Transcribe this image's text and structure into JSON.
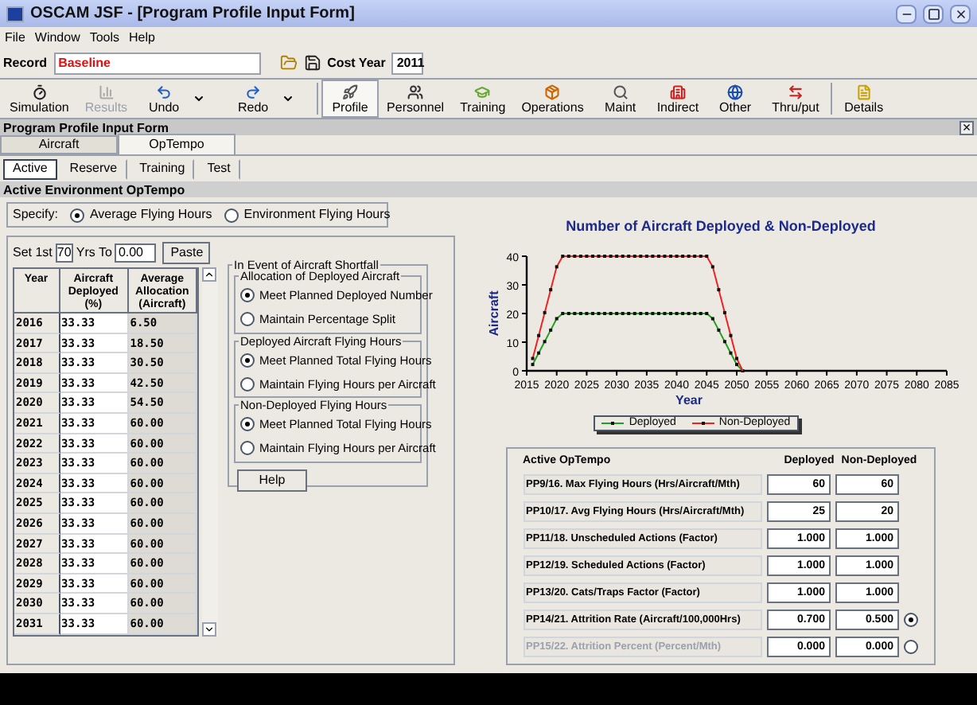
{
  "window": {
    "title": "OSCAM JSF - [Program Profile Input Form]"
  },
  "menu": [
    "File",
    "Window",
    "Tools",
    "Help"
  ],
  "record": {
    "label": "Record",
    "value": "Baseline",
    "cost_year_label": "Cost Year",
    "cost_year": "2011"
  },
  "toolbar": [
    {
      "label": "Simulation",
      "selected": false,
      "disabled": false,
      "kind": "plain"
    },
    {
      "label": "Results",
      "selected": false,
      "disabled": true,
      "kind": "plain"
    },
    {
      "label": "Undo",
      "selected": false,
      "disabled": false,
      "kind": "split"
    },
    {
      "label": "Redo",
      "selected": false,
      "disabled": false,
      "kind": "split"
    },
    {
      "label": "Profile",
      "selected": true,
      "disabled": false,
      "kind": "plain"
    },
    {
      "label": "Personnel",
      "selected": false,
      "disabled": false,
      "kind": "plain"
    },
    {
      "label": "Training",
      "selected": false,
      "disabled": false,
      "kind": "plain"
    },
    {
      "label": "Operations",
      "selected": false,
      "disabled": false,
      "kind": "plain"
    },
    {
      "label": "Maint",
      "selected": false,
      "disabled": false,
      "kind": "plain"
    },
    {
      "label": "Indirect",
      "selected": false,
      "disabled": false,
      "kind": "plain"
    },
    {
      "label": "Other",
      "selected": false,
      "disabled": false,
      "kind": "plain"
    },
    {
      "label": "Thru/put",
      "selected": false,
      "disabled": false,
      "kind": "plain"
    },
    {
      "label": "Details",
      "selected": false,
      "disabled": false,
      "kind": "plain"
    }
  ],
  "form": {
    "title": "Program Profile Input Form",
    "close": "×"
  },
  "tabs": [
    {
      "label": "Aircraft",
      "selected": false
    },
    {
      "label": "OpTempo",
      "selected": true
    }
  ],
  "subtabs": [
    {
      "label": "Active",
      "selected": true
    },
    {
      "label": "Reserve",
      "selected": false
    },
    {
      "label": "Training",
      "selected": false
    },
    {
      "label": "Test",
      "selected": false
    }
  ],
  "section_title": "Active Environment OpTempo",
  "specify": {
    "label": "Specify:",
    "options": [
      {
        "label": "Average Flying Hours",
        "selected": true
      },
      {
        "label": "Environment Flying Hours",
        "selected": false
      }
    ]
  },
  "set_row": {
    "set_label": "Set 1st",
    "years": "70",
    "yrs_to_label": "Yrs To",
    "value": "0.00",
    "paste": "Paste"
  },
  "table": {
    "columns": [
      "Year",
      "Aircraft Deployed (%)",
      "Average Allocation (Aircraft)"
    ],
    "rows": [
      [
        "2016",
        "33.33",
        "6.50"
      ],
      [
        "2017",
        "33.33",
        "18.50"
      ],
      [
        "2018",
        "33.33",
        "30.50"
      ],
      [
        "2019",
        "33.33",
        "42.50"
      ],
      [
        "2020",
        "33.33",
        "54.50"
      ],
      [
        "2021",
        "33.33",
        "60.00"
      ],
      [
        "2022",
        "33.33",
        "60.00"
      ],
      [
        "2023",
        "33.33",
        "60.00"
      ],
      [
        "2024",
        "33.33",
        "60.00"
      ],
      [
        "2025",
        "33.33",
        "60.00"
      ],
      [
        "2026",
        "33.33",
        "60.00"
      ],
      [
        "2027",
        "33.33",
        "60.00"
      ],
      [
        "2028",
        "33.33",
        "60.00"
      ],
      [
        "2029",
        "33.33",
        "60.00"
      ],
      [
        "2030",
        "33.33",
        "60.00"
      ],
      [
        "2031",
        "33.33",
        "60.00"
      ]
    ]
  },
  "shortfall": {
    "title": "In Event of Aircraft Shortfall",
    "groups": [
      {
        "title": "Allocation of Deployed Aircraft",
        "options": [
          {
            "label": "Meet Planned Deployed Number",
            "selected": true
          },
          {
            "label": "Maintain Percentage Split",
            "selected": false
          }
        ]
      },
      {
        "title": "Deployed Aircraft Flying Hours",
        "options": [
          {
            "label": "Meet Planned Total Flying Hours",
            "selected": true
          },
          {
            "label": "Maintain Flying Hours per Aircraft",
            "selected": false
          }
        ]
      },
      {
        "title": "Non-Deployed Flying Hours",
        "options": [
          {
            "label": "Meet Planned Total Flying Hours",
            "selected": true
          },
          {
            "label": "Maintain Flying Hours per Aircraft",
            "selected": false
          }
        ]
      }
    ],
    "help": "Help"
  },
  "chart": {
    "chart_data": {
      "type": "line",
      "title": "Number of Aircraft Deployed & Non-Deployed",
      "xlabel": "Year",
      "ylabel": "Aircraft",
      "x": [
        2016,
        2017,
        2018,
        2019,
        2020,
        2021,
        2022,
        2023,
        2024,
        2025,
        2026,
        2027,
        2028,
        2029,
        2030,
        2031,
        2032,
        2033,
        2034,
        2035,
        2036,
        2037,
        2038,
        2039,
        2040,
        2041,
        2042,
        2043,
        2044,
        2045,
        2046,
        2047,
        2048,
        2049,
        2050,
        2051
      ],
      "series": [
        {
          "name": "Deployed",
          "color": "#22a022",
          "marker": "square",
          "values": [
            2.2,
            6.2,
            10.2,
            14.2,
            18.2,
            20,
            20,
            20,
            20,
            20,
            20,
            20,
            20,
            20,
            20,
            20,
            20,
            20,
            20,
            20,
            20,
            20,
            20,
            20,
            20,
            20,
            20,
            20,
            20,
            20,
            18.2,
            14.2,
            10.2,
            6.2,
            2.2,
            0
          ]
        },
        {
          "name": "Non-Deployed",
          "color": "#ee2222",
          "marker": "square",
          "values": [
            4.3,
            12.3,
            20.3,
            28.3,
            36.3,
            40,
            40,
            40,
            40,
            40,
            40,
            40,
            40,
            40,
            40,
            40,
            40,
            40,
            40,
            40,
            40,
            40,
            40,
            40,
            40,
            40,
            40,
            40,
            40,
            40,
            36.3,
            28.3,
            20.3,
            12.3,
            4.3,
            0
          ]
        }
      ],
      "xlim": [
        2015,
        2085
      ],
      "ylim": [
        0,
        40
      ],
      "xticks": [
        2015,
        2020,
        2025,
        2030,
        2035,
        2040,
        2045,
        2050,
        2055,
        2060,
        2065,
        2070,
        2075,
        2080,
        2085
      ],
      "yticks": [
        0,
        10,
        20,
        30,
        40
      ]
    }
  },
  "params": {
    "columns": [
      "Active OpTempo",
      "Deployed",
      "Non-Deployed"
    ],
    "rows": [
      {
        "label": "PP9/16. Max Flying Hours (Hrs/Aircraft/Mth)",
        "deployed": "60",
        "non_deployed": "60",
        "disabled": false,
        "kind": "plain"
      },
      {
        "label": "PP10/17. Avg Flying Hours (Hrs/Aircraft/Mth)",
        "deployed": "25",
        "non_deployed": "20",
        "disabled": false,
        "kind": "plain"
      },
      {
        "label": "PP11/18. Unscheduled Actions (Factor)",
        "deployed": "1.000",
        "non_deployed": "1.000",
        "disabled": false,
        "kind": "plain"
      },
      {
        "label": "PP12/19. Scheduled Actions (Factor)",
        "deployed": "1.000",
        "non_deployed": "1.000",
        "disabled": false,
        "kind": "plain"
      },
      {
        "label": "PP13/20. Cats/Traps Factor (Factor)",
        "deployed": "1.000",
        "non_deployed": "1.000",
        "disabled": false,
        "kind": "plain"
      },
      {
        "label": "PP14/21. Attrition Rate (Aircraft/100,000Hrs)",
        "deployed": "0.700",
        "non_deployed": "0.500",
        "disabled": false,
        "kind": "radio",
        "selected": true
      },
      {
        "label": "PP15/22. Attrition Percent (Percent/Mth)",
        "deployed": "0.000",
        "non_deployed": "0.000",
        "disabled": true,
        "kind": "radio",
        "selected": false
      }
    ]
  }
}
